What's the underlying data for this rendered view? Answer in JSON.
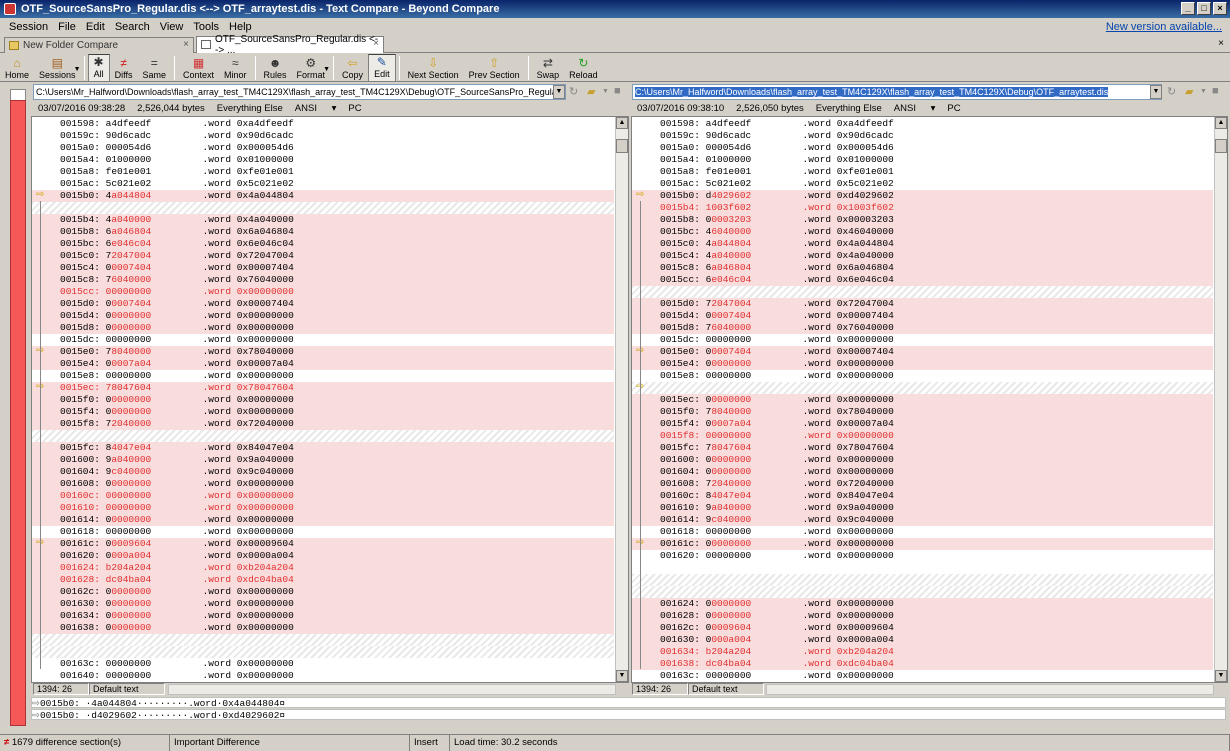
{
  "window": {
    "title": "OTF_SourceSansPro_Regular.dis <--> OTF_arraytest.dis - Text Compare - Beyond Compare"
  },
  "menu": [
    "Session",
    "File",
    "Edit",
    "Search",
    "View",
    "Tools",
    "Help"
  ],
  "new_version": "New version available...",
  "tabs": [
    {
      "label": "New Folder Compare"
    },
    {
      "label": "OTF_SourceSansPro_Regular.dis <--> ..."
    }
  ],
  "toolbar": [
    {
      "label": "Home",
      "icon": "home-icon"
    },
    {
      "label": "Sessions",
      "icon": "sessions-icon"
    },
    {
      "label": "All",
      "icon": "star-icon"
    },
    {
      "label": "Diffs",
      "icon": "diffs-icon"
    },
    {
      "label": "Same",
      "icon": "equals-icon"
    },
    {
      "label": "Context",
      "icon": "context-icon"
    },
    {
      "label": "Minor",
      "icon": "minor-icon"
    },
    {
      "label": "Rules",
      "icon": "rules-icon"
    },
    {
      "label": "Format",
      "icon": "format-icon"
    },
    {
      "label": "Copy",
      "icon": "copy-icon"
    },
    {
      "label": "Edit",
      "icon": "edit-icon"
    },
    {
      "label": "Next Section",
      "icon": "down-arrow-icon"
    },
    {
      "label": "Prev Section",
      "icon": "up-arrow-icon"
    },
    {
      "label": "Swap",
      "icon": "swap-icon"
    },
    {
      "label": "Reload",
      "icon": "reload-icon"
    }
  ],
  "left": {
    "path": "C:\\Users\\Mr_Halfword\\Downloads\\flash_array_test_TM4C129X\\flash_array_test_TM4C129X\\Debug\\OTF_SourceSansPro_Regular.dis",
    "date": "03/07/2016 09:38:28",
    "size": "2,526,044 bytes",
    "filter": "Everything Else",
    "encoding": "ANSI",
    "lineend": "PC",
    "pos": "1394: 26",
    "format": "Default text"
  },
  "right": {
    "path": "C:\\Users\\Mr_Halfword\\Downloads\\flash_array_test_TM4C129X\\flash_array_test_TM4C129X\\Debug\\OTF_arraytest.dis",
    "date": "03/07/2016 09:38:10",
    "size": "2,526,050 bytes",
    "filter": "Everything Else",
    "encoding": "ANSI",
    "lineend": "PC",
    "pos": "1394: 26",
    "format": "Default text"
  },
  "left_rows": [
    {
      "a": "001598:",
      "v": "a4dfeedf",
      "w": ".word 0xa4dfeedf",
      "t": "n"
    },
    {
      "a": "00159c:",
      "v": "90d6cadc",
      "w": ".word 0x90d6cadc",
      "t": "n"
    },
    {
      "a": "0015a0:",
      "v": "000054d6",
      "w": ".word 0x000054d6",
      "t": "n"
    },
    {
      "a": "0015a4:",
      "v": "01000000",
      "w": ".word 0x01000000",
      "t": "n"
    },
    {
      "a": "0015a8:",
      "v": "fe01e001",
      "w": ".word 0xfe01e001",
      "t": "n"
    },
    {
      "a": "0015ac:",
      "v": "5c021e02",
      "w": ".word 0x5c021e02",
      "t": "n"
    },
    {
      "a": "0015b0:",
      "v": "4a044804",
      "w": ".word 0x4a044804",
      "t": "d",
      "arr": true
    },
    {
      "t": "p"
    },
    {
      "a": "0015b4:",
      "v": "4a040000",
      "w": ".word 0x4a040000",
      "t": "d"
    },
    {
      "a": "0015b8:",
      "v": "6a046804",
      "w": ".word 0x6a046804",
      "t": "d"
    },
    {
      "a": "0015bc:",
      "v": "6e046c04",
      "w": ".word 0x6e046c04",
      "t": "d"
    },
    {
      "a": "0015c0:",
      "v": "72047004",
      "w": ".word 0x72047004",
      "t": "d"
    },
    {
      "a": "0015c4:",
      "v": "00007404",
      "w": ".word 0x00007404",
      "t": "d"
    },
    {
      "a": "0015c8:",
      "v": "76040000",
      "w": ".word 0x76040000",
      "t": "d"
    },
    {
      "a": "0015cc:",
      "v": "00000000",
      "w": ".word 0x00000000",
      "t": "r"
    },
    {
      "a": "0015d0:",
      "v": "00007404",
      "w": ".word 0x00007404",
      "t": "d"
    },
    {
      "a": "0015d4:",
      "v": "00000000",
      "w": ".word 0x00000000",
      "t": "d"
    },
    {
      "a": "0015d8:",
      "v": "00000000",
      "w": ".word 0x00000000",
      "t": "d"
    },
    {
      "a": "0015dc:",
      "v": "00000000",
      "w": ".word 0x00000000",
      "t": "n"
    },
    {
      "a": "0015e0:",
      "v": "78040000",
      "w": ".word 0x78040000",
      "t": "d",
      "arr": true
    },
    {
      "a": "0015e4:",
      "v": "00007a04",
      "w": ".word 0x00007a04",
      "t": "d"
    },
    {
      "a": "0015e8:",
      "v": "00000000",
      "w": ".word 0x00000000",
      "t": "n"
    },
    {
      "a": "0015ec:",
      "v": "78047604",
      "w": ".word 0x78047604",
      "t": "r",
      "arr": true
    },
    {
      "a": "0015f0:",
      "v": "00000000",
      "w": ".word 0x00000000",
      "t": "d"
    },
    {
      "a": "0015f4:",
      "v": "00000000",
      "w": ".word 0x00000000",
      "t": "d"
    },
    {
      "a": "0015f8:",
      "v": "72040000",
      "w": ".word 0x72040000",
      "t": "d"
    },
    {
      "t": "p"
    },
    {
      "a": "0015fc:",
      "v": "84047e04",
      "w": ".word 0x84047e04",
      "t": "d"
    },
    {
      "a": "001600:",
      "v": "9a040000",
      "w": ".word 0x9a040000",
      "t": "d"
    },
    {
      "a": "001604:",
      "v": "9c040000",
      "w": ".word 0x9c040000",
      "t": "d"
    },
    {
      "a": "001608:",
      "v": "00000000",
      "w": ".word 0x00000000",
      "t": "d"
    },
    {
      "a": "00160c:",
      "v": "00000000",
      "w": ".word 0x00000000",
      "t": "r"
    },
    {
      "a": "001610:",
      "v": "00000000",
      "w": ".word 0x00000000",
      "t": "r"
    },
    {
      "a": "001614:",
      "v": "00000000",
      "w": ".word 0x00000000",
      "t": "d"
    },
    {
      "a": "001618:",
      "v": "00000000",
      "w": ".word 0x00000000",
      "t": "n"
    },
    {
      "a": "00161c:",
      "v": "00009604",
      "w": ".word 0x00009604",
      "t": "d",
      "arr": true
    },
    {
      "a": "001620:",
      "v": "0000a004",
      "w": ".word 0x0000a004",
      "t": "d"
    },
    {
      "a": "001624:",
      "v": "b204a204",
      "w": ".word 0xb204a204",
      "t": "r"
    },
    {
      "a": "001628:",
      "v": "dc04ba04",
      "w": ".word 0xdc04ba04",
      "t": "r"
    },
    {
      "a": "00162c:",
      "v": "00000000",
      "w": ".word 0x00000000",
      "t": "d"
    },
    {
      "a": "001630:",
      "v": "00000000",
      "w": ".word 0x00000000",
      "t": "d"
    },
    {
      "a": "001634:",
      "v": "00000000",
      "w": ".word 0x00000000",
      "t": "d"
    },
    {
      "a": "001638:",
      "v": "00000000",
      "w": ".word 0x00000000",
      "t": "d"
    },
    {
      "t": "p"
    },
    {
      "t": "p"
    },
    {
      "a": "00163c:",
      "v": "00000000",
      "w": ".word 0x00000000",
      "t": "n"
    },
    {
      "a": "001640:",
      "v": "00000000",
      "w": ".word 0x00000000",
      "t": "n"
    }
  ],
  "right_rows": [
    {
      "a": "001598:",
      "v": "a4dfeedf",
      "w": ".word 0xa4dfeedf",
      "t": "n"
    },
    {
      "a": "00159c:",
      "v": "90d6cadc",
      "w": ".word 0x90d6cadc",
      "t": "n"
    },
    {
      "a": "0015a0:",
      "v": "000054d6",
      "w": ".word 0x000054d6",
      "t": "n"
    },
    {
      "a": "0015a4:",
      "v": "01000000",
      "w": ".word 0x01000000",
      "t": "n"
    },
    {
      "a": "0015a8:",
      "v": "fe01e001",
      "w": ".word 0xfe01e001",
      "t": "n"
    },
    {
      "a": "0015ac:",
      "v": "5c021e02",
      "w": ".word 0x5c021e02",
      "t": "n"
    },
    {
      "a": "0015b0:",
      "v": "d4029602",
      "w": ".word 0xd4029602",
      "t": "d",
      "arr": true
    },
    {
      "a": "0015b4:",
      "v": "1003f602",
      "w": ".word 0x1003f602",
      "t": "r"
    },
    {
      "a": "0015b8:",
      "v": "00003203",
      "w": ".word 0x00003203",
      "t": "d"
    },
    {
      "a": "0015bc:",
      "v": "46040000",
      "w": ".word 0x46040000",
      "t": "d"
    },
    {
      "a": "0015c0:",
      "v": "4a044804",
      "w": ".word 0x4a044804",
      "t": "d"
    },
    {
      "a": "0015c4:",
      "v": "4a040000",
      "w": ".word 0x4a040000",
      "t": "d"
    },
    {
      "a": "0015c8:",
      "v": "6a046804",
      "w": ".word 0x6a046804",
      "t": "d"
    },
    {
      "a": "0015cc:",
      "v": "6e046c04",
      "w": ".word 0x6e046c04",
      "t": "d"
    },
    {
      "t": "p"
    },
    {
      "a": "0015d0:",
      "v": "72047004",
      "w": ".word 0x72047004",
      "t": "d"
    },
    {
      "a": "0015d4:",
      "v": "00007404",
      "w": ".word 0x00007404",
      "t": "d"
    },
    {
      "a": "0015d8:",
      "v": "76040000",
      "w": ".word 0x76040000",
      "t": "d"
    },
    {
      "a": "0015dc:",
      "v": "00000000",
      "w": ".word 0x00000000",
      "t": "n"
    },
    {
      "a": "0015e0:",
      "v": "00007404",
      "w": ".word 0x00007404",
      "t": "d",
      "arr": true
    },
    {
      "a": "0015e4:",
      "v": "00000000",
      "w": ".word 0x00000000",
      "t": "d"
    },
    {
      "a": "0015e8:",
      "v": "00000000",
      "w": ".word 0x00000000",
      "t": "n"
    },
    {
      "t": "p",
      "arr": true
    },
    {
      "a": "0015ec:",
      "v": "00000000",
      "w": ".word 0x00000000",
      "t": "d"
    },
    {
      "a": "0015f0:",
      "v": "78040000",
      "w": ".word 0x78040000",
      "t": "d"
    },
    {
      "a": "0015f4:",
      "v": "00007a04",
      "w": ".word 0x00007a04",
      "t": "d"
    },
    {
      "a": "0015f8:",
      "v": "00000000",
      "w": ".word 0x00000000",
      "t": "r"
    },
    {
      "a": "0015fc:",
      "v": "78047604",
      "w": ".word 0x78047604",
      "t": "d"
    },
    {
      "a": "001600:",
      "v": "00000000",
      "w": ".word 0x00000000",
      "t": "d"
    },
    {
      "a": "001604:",
      "v": "00000000",
      "w": ".word 0x00000000",
      "t": "d"
    },
    {
      "a": "001608:",
      "v": "72040000",
      "w": ".word 0x72040000",
      "t": "d"
    },
    {
      "a": "00160c:",
      "v": "84047e04",
      "w": ".word 0x84047e04",
      "t": "d"
    },
    {
      "a": "001610:",
      "v": "9a040000",
      "w": ".word 0x9a040000",
      "t": "d"
    },
    {
      "a": "001614:",
      "v": "9c040000",
      "w": ".word 0x9c040000",
      "t": "d"
    },
    {
      "a": "001618:",
      "v": "00000000",
      "w": ".word 0x00000000",
      "t": "n"
    },
    {
      "a": "00161c:",
      "v": "00000000",
      "w": ".word 0x00000000",
      "t": "d",
      "arr": true
    },
    {
      "a": "001620:",
      "v": "00000000",
      "w": ".word 0x00000000",
      "t": "n"
    },
    {
      "t": "e"
    },
    {
      "t": "p"
    },
    {
      "t": "p"
    },
    {
      "a": "001624:",
      "v": "00000000",
      "w": ".word 0x00000000",
      "t": "d"
    },
    {
      "a": "001628:",
      "v": "00000000",
      "w": ".word 0x00000000",
      "t": "d"
    },
    {
      "a": "00162c:",
      "v": "00009604",
      "w": ".word 0x00009604",
      "t": "d"
    },
    {
      "a": "001630:",
      "v": "0000a004",
      "w": ".word 0x0000a004",
      "t": "d"
    },
    {
      "a": "001634:",
      "v": "b204a204",
      "w": ".word 0xb204a204",
      "t": "r"
    },
    {
      "a": "001638:",
      "v": "dc04ba04",
      "w": ".word 0xdc04ba04",
      "t": "r"
    },
    {
      "a": "00163c:",
      "v": "00000000",
      "w": ".word 0x00000000",
      "t": "n"
    },
    {
      "a": "001640:",
      "v": "00000000",
      "w": ".word 0x00000000",
      "t": "n"
    }
  ],
  "compare": {
    "line1": "0015b0: ·4a044804·········.word·0x4a044804¤",
    "line2": "0015b0: ·d4029602·········.word·0xd4029602¤"
  },
  "statusbar": {
    "diffs": "1679 difference section(s)",
    "importance": "Important Difference",
    "mode": "Insert",
    "load": "Load time: 30.2 seconds"
  },
  "colors": {
    "diff_bg": "#f9dcdc",
    "diff_text": "#e03030",
    "title_bg": "#0a246a"
  }
}
